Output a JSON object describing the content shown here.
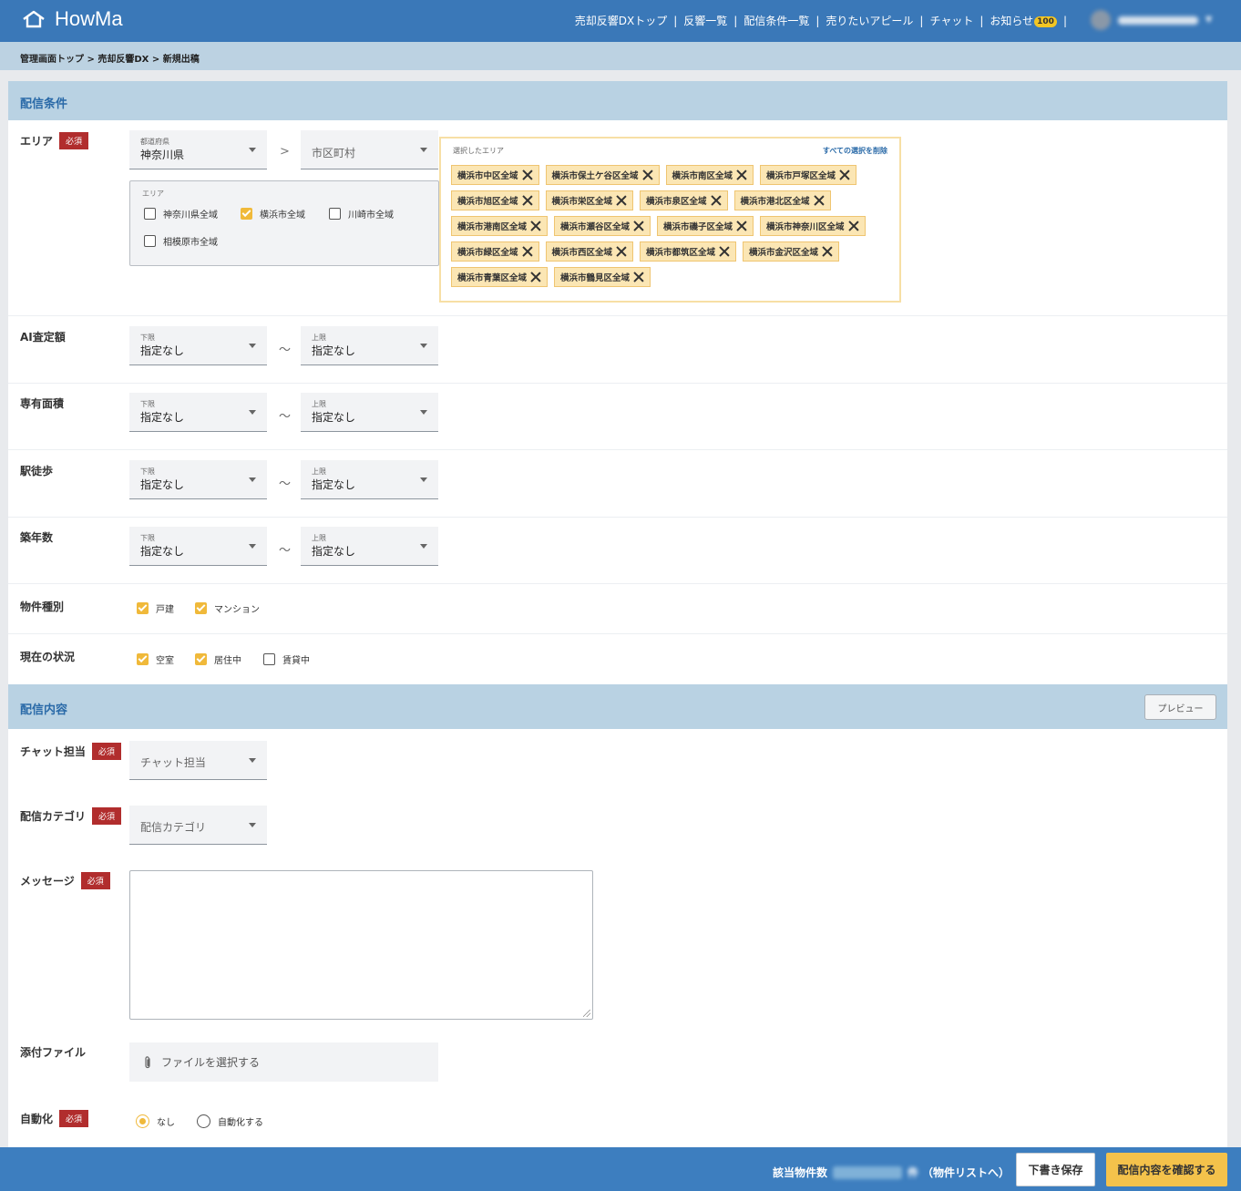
{
  "app": {
    "logo": "HowMa"
  },
  "nav": {
    "items": [
      "売却反響DXトップ",
      "反響一覧",
      "配信条件一覧",
      "売りたいアピール",
      "チャット",
      "お知らせ"
    ],
    "notification_count": "100",
    "separator": "|"
  },
  "breadcrumb": "管理画面トップ > 売却反響DX > 新規出稿",
  "section1": {
    "title": "配信条件"
  },
  "required_label": "必須",
  "area": {
    "label": "エリア",
    "prefecture": {
      "caption": "都道府県",
      "value": "神奈川県"
    },
    "gt": ">",
    "city": {
      "placeholder": "市区町村"
    },
    "options_caption": "エリア",
    "options": [
      {
        "label": "神奈川県全域",
        "checked": false
      },
      {
        "label": "横浜市全域",
        "checked": true
      },
      {
        "label": "川崎市全域",
        "checked": false
      },
      {
        "label": "相模原市全域",
        "checked": false
      }
    ],
    "selected_caption": "選択したエリア",
    "clear_all": "すべての選択を削除",
    "chips": [
      "横浜市中区全域",
      "横浜市保土ケ谷区全域",
      "横浜市南区全域",
      "横浜市戸塚区全域",
      "横浜市旭区全域",
      "横浜市栄区全域",
      "横浜市泉区全域",
      "横浜市港北区全域",
      "横浜市港南区全域",
      "横浜市瀬谷区全域",
      "横浜市磯子区全域",
      "横浜市神奈川区全域",
      "横浜市緑区全域",
      "横浜市西区全域",
      "横浜市都筑区全域",
      "横浜市金沢区全域",
      "横浜市青葉区全域",
      "横浜市鶴見区全域"
    ]
  },
  "range": {
    "lower_caption": "下限",
    "upper_caption": "上限",
    "default_value": "指定なし",
    "tilde": "〜"
  },
  "ranges": [
    {
      "label": "AI査定額"
    },
    {
      "label": "専有面積"
    },
    {
      "label": "駅徒歩"
    },
    {
      "label": "築年数"
    }
  ],
  "property_type": {
    "label": "物件種別",
    "options": [
      {
        "label": "戸建",
        "checked": true
      },
      {
        "label": "マンション",
        "checked": true
      }
    ]
  },
  "status": {
    "label": "現在の状況",
    "options": [
      {
        "label": "空室",
        "checked": true
      },
      {
        "label": "居住中",
        "checked": true
      },
      {
        "label": "賃貸中",
        "checked": false
      }
    ]
  },
  "section2": {
    "title": "配信内容",
    "preview_button": "プレビュー"
  },
  "chat": {
    "label": "チャット担当",
    "placeholder": "チャット担当"
  },
  "category": {
    "label": "配信カテゴリ",
    "placeholder": "配信カテゴリ"
  },
  "message": {
    "label": "メッセージ",
    "value": ""
  },
  "attachment": {
    "label": "添付ファイル",
    "button": "ファイルを選択する"
  },
  "automation": {
    "label": "自動化",
    "options": [
      {
        "label": "なし",
        "selected": true
      },
      {
        "label": "自動化する",
        "selected": false
      }
    ]
  },
  "footer": {
    "count_label": "該当物件数",
    "count_suffix": "件",
    "list_link": "（物件リストへ）",
    "draft_button": "下書き保存",
    "confirm_button": "配信内容を確認する"
  }
}
